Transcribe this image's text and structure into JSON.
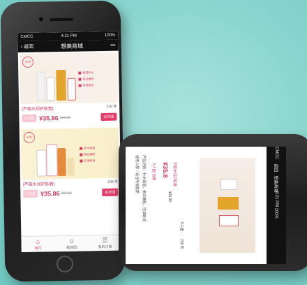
{
  "status": {
    "carrier": "CMCC",
    "time": "4:21 PM",
    "battery": "100%"
  },
  "nav": {
    "back_label": "返回",
    "title": "想美商城",
    "more": "•••"
  },
  "products": [
    {
      "badge": "热卖",
      "bullets": [
        "保湿补水",
        "美白嫩肤",
        "保湿锁水"
      ],
      "name": "[芦荟水润护肤套]",
      "sold": "238 件",
      "group": "5人团",
      "price": "¥35.86",
      "orig_price": "¥99.86",
      "open_label": "去开团"
    },
    {
      "badge": "热卖",
      "bullets": [
        "补水保湿",
        "美白嫩肤",
        "控油收敛"
      ],
      "name": "[芦荟水润护肤套]",
      "sold": "238 件",
      "group": "5人团",
      "price": "¥35.86",
      "orig_price": "¥99.86",
      "open_label": "去开团"
    }
  ],
  "tabs": [
    {
      "label": "首页",
      "icon": "⌂"
    },
    {
      "label": "我的团",
      "icon": "☺"
    },
    {
      "label": "我的订单",
      "icon": "☰"
    }
  ],
  "phone2": {
    "status_time": "4:21 PM",
    "carrier": "CMCC",
    "battery": "100%",
    "back_label": "返回",
    "title": "想美商城",
    "name": "芦荟水润护肤套",
    "price": "¥35.8",
    "orig_price": "¥99.80",
    "group_label": "5人团",
    "sold": "238 件",
    "promo": "5人团·包邮",
    "desc1": "产品功效：补水保湿，美白嫩肤，控油收敛",
    "desc2": "适用人群：适合所有肤质"
  },
  "colors": {
    "accent": "#e23c6a",
    "bg": "#86d3cd"
  }
}
